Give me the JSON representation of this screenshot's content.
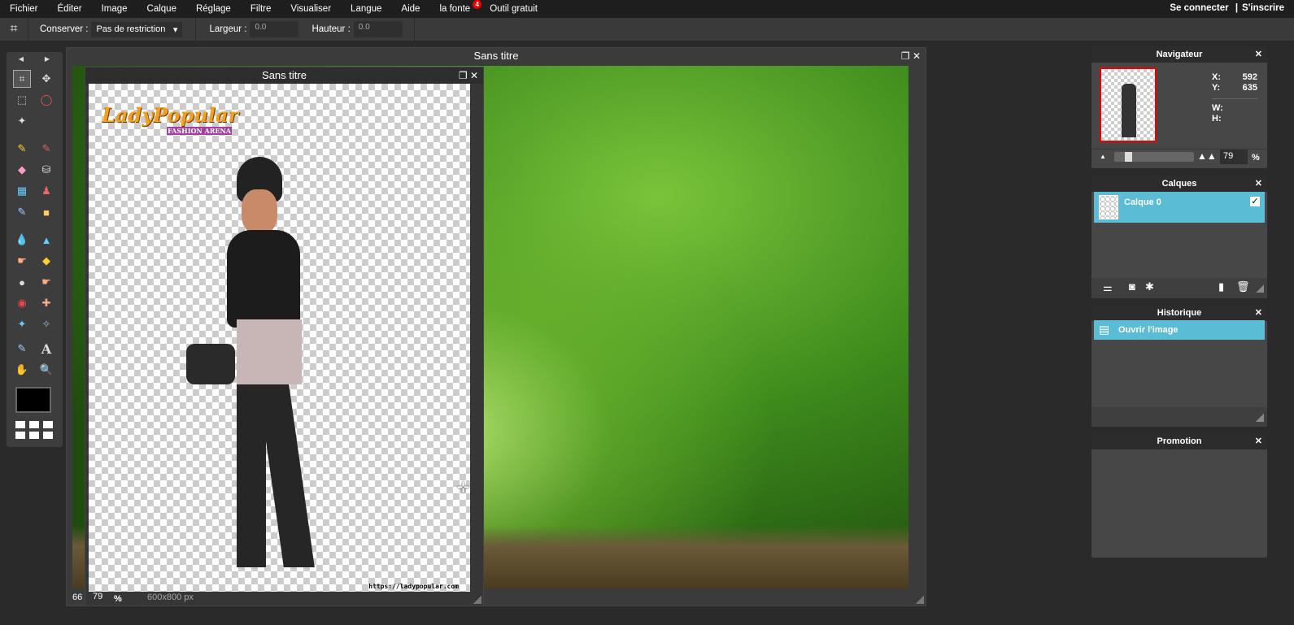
{
  "menu": [
    "Fichier",
    "Éditer",
    "Image",
    "Calque",
    "Réglage",
    "Filtre",
    "Visualiser",
    "Langue",
    "Aide",
    "la fonte",
    "Outil gratuit"
  ],
  "menu_badge": "4",
  "auth": {
    "login": "Se connecter",
    "sep": "|",
    "signup": "S'inscrire"
  },
  "toolbar": {
    "keep_label": "Conserver :",
    "keep_value": "Pas de restriction",
    "width_label": "Largeur :",
    "width_value": "0.0",
    "height_label": "Hauteur :",
    "height_value": "0.0"
  },
  "back_window": {
    "title": "Sans titre",
    "zoom": "66"
  },
  "front_window": {
    "title": "Sans titre",
    "zoom": "79",
    "pct": "%",
    "size": "600x800 px",
    "logo": "LadyPopular FASHION ARENA",
    "url": "https://ladypopular.com"
  },
  "navigator": {
    "title": "Navigateur",
    "x_label": "X:",
    "x": "592",
    "y_label": "Y:",
    "y": "635",
    "w_label": "W:",
    "h_label": "H:",
    "zoom": "79",
    "pct": "%",
    "zoom_fraction": 0.15
  },
  "layers": {
    "title": "Calques",
    "items": [
      {
        "name": "Calque 0",
        "visible": true
      }
    ]
  },
  "history": {
    "title": "Historique",
    "items": [
      "Ouvrir l'image"
    ]
  },
  "promotion": {
    "title": "Promotion"
  },
  "colors": {
    "accent": "#5bbcd6",
    "foreground": "#000000"
  }
}
